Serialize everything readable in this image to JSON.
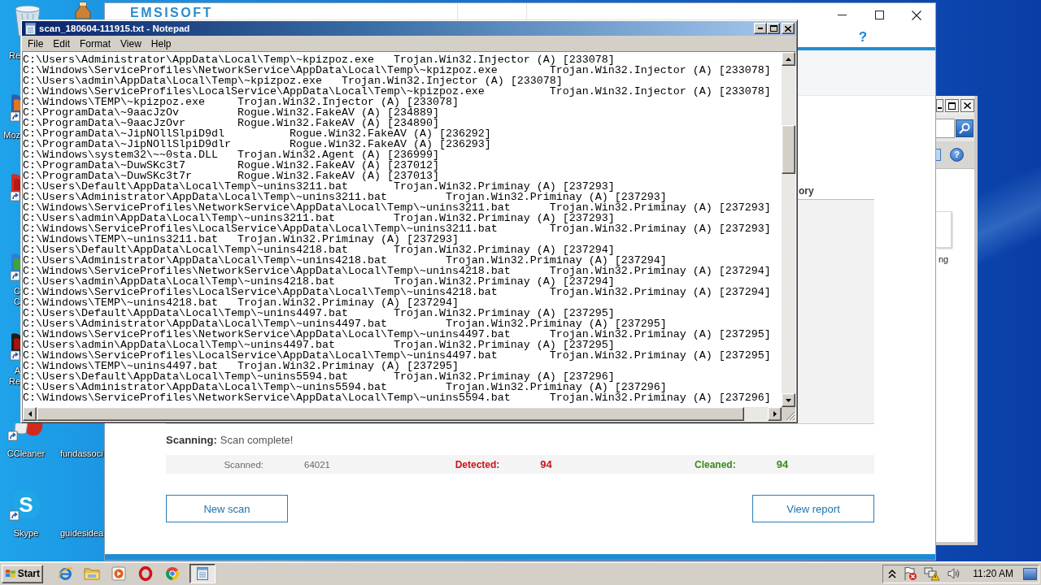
{
  "desktop": {
    "icons": [
      {
        "kind": "bin",
        "label": "Re"
      },
      {
        "kind": "tile"
      },
      {
        "kind": "fox",
        "label": "Moz"
      },
      {
        "kind": "ring"
      },
      {
        "kind": "leaf",
        "label": "C\nC"
      },
      {
        "kind": "reader",
        "label": "A\nRe"
      },
      {
        "kind": "cleaner",
        "label": "CCleaner"
      },
      {
        "label": "fundassoci"
      },
      {
        "kind": "chat",
        "letter": "S",
        "label": "Skype"
      },
      {
        "label": "guidesidea"
      }
    ]
  },
  "side_window": {
    "help": "?",
    "text": "ng"
  },
  "scanner_window": {
    "logo": "EMSISOFT",
    "help": "?",
    "tab": "ory",
    "status": {
      "label": "Scanning:",
      "text": "Scan complete!"
    },
    "stats": [
      {
        "kind": "scanned",
        "label": "Scanned:",
        "value": "64021"
      },
      {
        "kind": "detected",
        "label": "Detected:",
        "value": "94"
      },
      {
        "kind": "cleaned",
        "label": "Cleaned:",
        "value": "94"
      }
    ],
    "buttons": [
      "New scan",
      "View report"
    ]
  },
  "notepad": {
    "title": "scan_180604-111915.txt - Notepad",
    "menu": [
      "File",
      "Edit",
      "Format",
      "View",
      "Help"
    ],
    "lines": [
      "C:\\Users\\Administrator\\AppData\\Local\\Temp\\~kpizpoz.exe   Trojan.Win32.Injector (A) [233078]",
      "C:\\Windows\\ServiceProfiles\\NetworkService\\AppData\\Local\\Temp\\~kpizpoz.exe        Trojan.Win32.Injector (A) [233078]",
      "C:\\Users\\admin\\AppData\\Local\\Temp\\~kpizpoz.exe   Trojan.Win32.Injector (A) [233078]",
      "C:\\Windows\\ServiceProfiles\\LocalService\\AppData\\Local\\Temp\\~kpizpoz.exe          Trojan.Win32.Injector (A) [233078]",
      "C:\\Windows\\TEMP\\~kpizpoz.exe     Trojan.Win32.Injector (A) [233078]",
      "C:\\ProgramData\\~9aacJzOv         Rogue.Win32.FakeAV (A) [234889]",
      "C:\\ProgramData\\~9aacJzOvr        Rogue.Win32.FakeAV (A) [234890]",
      "C:\\ProgramData\\~JipNOllSlpiD9dl          Rogue.Win32.FakeAV (A) [236292]",
      "C:\\ProgramData\\~JipNOllSlpiD9dlr         Rogue.Win32.FakeAV (A) [236293]",
      "C:\\Windows\\system32\\~~0sta.DLL   Trojan.Win32.Agent (A) [236999]",
      "C:\\ProgramData\\~DuwSKc3t7        Rogue.Win32.FakeAV (A) [237012]",
      "C:\\ProgramData\\~DuwSKc3t7r       Rogue.Win32.FakeAV (A) [237013]",
      "C:\\Users\\Default\\AppData\\Local\\Temp\\~unins3211.bat       Trojan.Win32.Priminay (A) [237293]",
      "C:\\Users\\Administrator\\AppData\\Local\\Temp\\~unins3211.bat         Trojan.Win32.Priminay (A) [237293]",
      "C:\\Windows\\ServiceProfiles\\NetworkService\\AppData\\Local\\Temp\\~unins3211.bat      Trojan.Win32.Priminay (A) [237293]",
      "C:\\Users\\admin\\AppData\\Local\\Temp\\~unins3211.bat         Trojan.Win32.Priminay (A) [237293]",
      "C:\\Windows\\ServiceProfiles\\LocalService\\AppData\\Local\\Temp\\~unins3211.bat        Trojan.Win32.Priminay (A) [237293]",
      "C:\\Windows\\TEMP\\~unins3211.bat   Trojan.Win32.Priminay (A) [237293]",
      "C:\\Users\\Default\\AppData\\Local\\Temp\\~unins4218.bat       Trojan.Win32.Priminay (A) [237294]",
      "C:\\Users\\Administrator\\AppData\\Local\\Temp\\~unins4218.bat         Trojan.Win32.Priminay (A) [237294]",
      "C:\\Windows\\ServiceProfiles\\NetworkService\\AppData\\Local\\Temp\\~unins4218.bat      Trojan.Win32.Priminay (A) [237294]",
      "C:\\Users\\admin\\AppData\\Local\\Temp\\~unins4218.bat         Trojan.Win32.Priminay (A) [237294]",
      "C:\\Windows\\ServiceProfiles\\LocalService\\AppData\\Local\\Temp\\~unins4218.bat        Trojan.Win32.Priminay (A) [237294]",
      "C:\\Windows\\TEMP\\~unins4218.bat   Trojan.Win32.Priminay (A) [237294]",
      "C:\\Users\\Default\\AppData\\Local\\Temp\\~unins4497.bat       Trojan.Win32.Priminay (A) [237295]",
      "C:\\Users\\Administrator\\AppData\\Local\\Temp\\~unins4497.bat         Trojan.Win32.Priminay (A) [237295]",
      "C:\\Windows\\ServiceProfiles\\NetworkService\\AppData\\Local\\Temp\\~unins4497.bat      Trojan.Win32.Priminay (A) [237295]",
      "C:\\Users\\admin\\AppData\\Local\\Temp\\~unins4497.bat         Trojan.Win32.Priminay (A) [237295]",
      "C:\\Windows\\ServiceProfiles\\LocalService\\AppData\\Local\\Temp\\~unins4497.bat        Trojan.Win32.Priminay (A) [237295]",
      "C:\\Windows\\TEMP\\~unins4497.bat   Trojan.Win32.Priminay (A) [237295]",
      "C:\\Users\\Default\\AppData\\Local\\Temp\\~unins5594.bat       Trojan.Win32.Priminay (A) [237296]",
      "C:\\Users\\Administrator\\AppData\\Local\\Temp\\~unins5594.bat         Trojan.Win32.Priminay (A) [237296]",
      "C:\\Windows\\ServiceProfiles\\NetworkService\\AppData\\Local\\Temp\\~unins5594.bat      Trojan.Win32.Priminay (A) [237296]"
    ]
  },
  "taskbar": {
    "start": "Start",
    "apps": [
      {
        "kind": "globe",
        "selected": false
      },
      {
        "kind": "folder",
        "selected": false
      },
      {
        "kind": "player",
        "selected": false
      },
      {
        "kind": "ring",
        "selected": false
      },
      {
        "kind": "wheel",
        "selected": false
      },
      {
        "kind": "notepad",
        "selected": true
      }
    ],
    "clock": "11:20 AM"
  }
}
